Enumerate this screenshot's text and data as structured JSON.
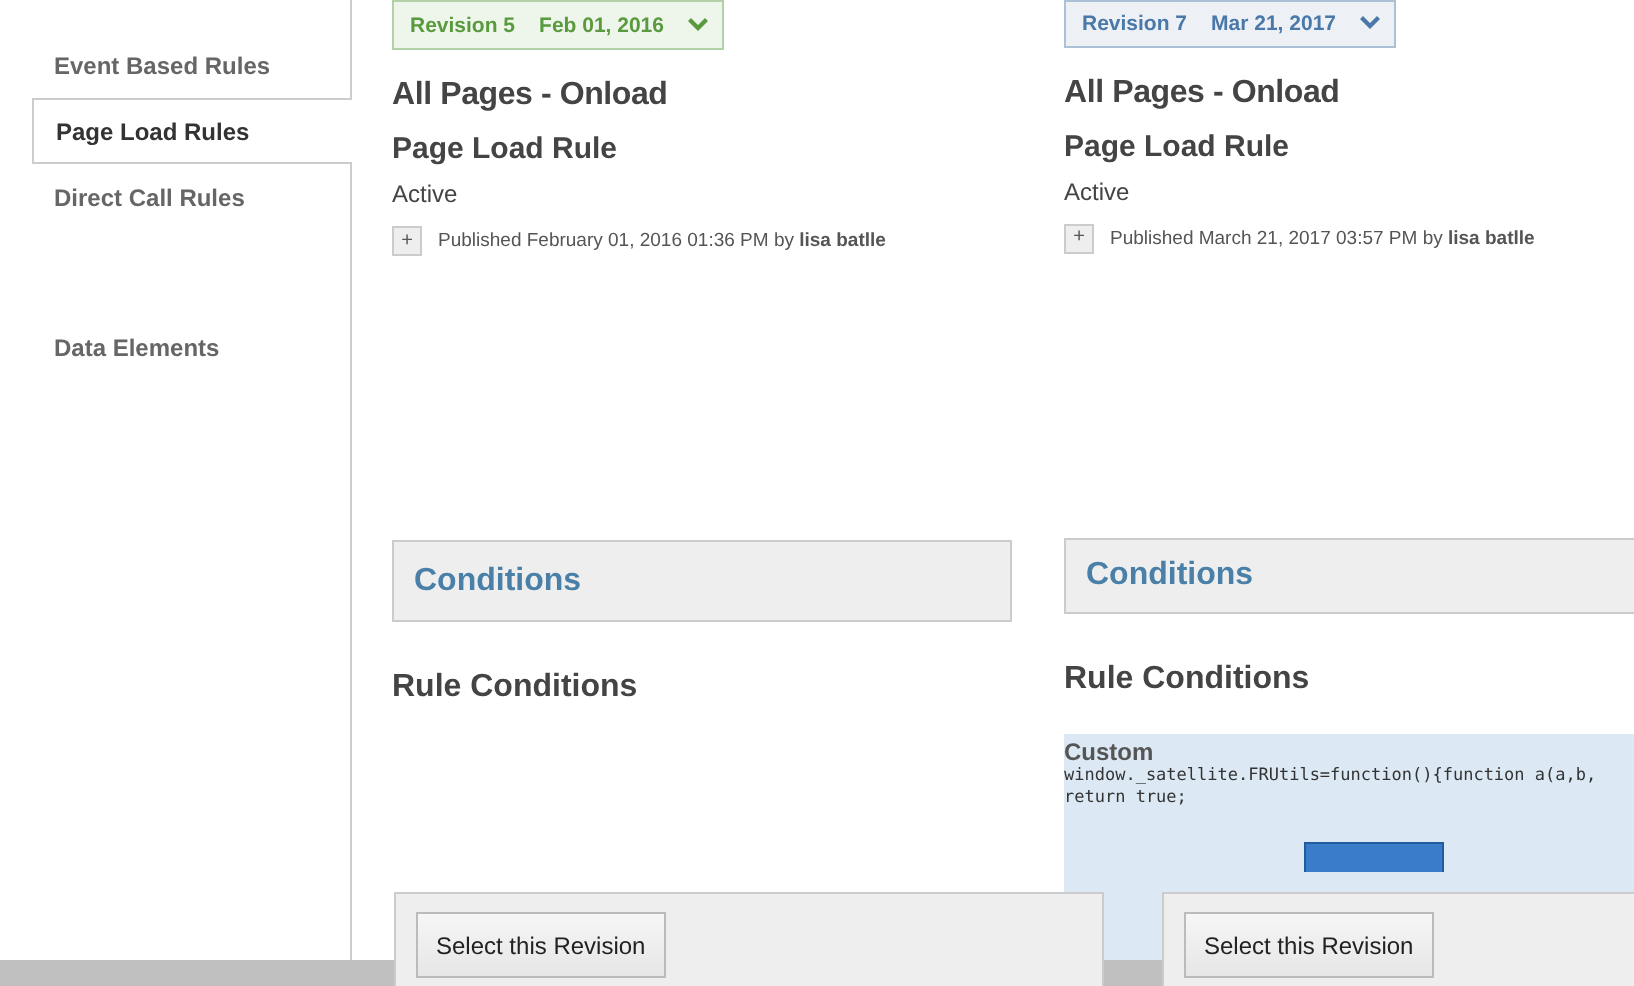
{
  "sidebar": {
    "items": [
      {
        "label": "Event Based Rules",
        "selected": false
      },
      {
        "label": "Page Load Rules",
        "selected": true
      },
      {
        "label": "Direct Call Rules",
        "selected": false
      },
      {
        "label": "Data Elements",
        "selected": false
      }
    ]
  },
  "revisions": [
    {
      "badge": {
        "revision": "Revision 5",
        "date": "Feb 01, 2016",
        "color": "#5a9a3e"
      },
      "name": "All Pages - Onload",
      "type": "Page Load Rule",
      "status": "Active",
      "expand_icon": "+",
      "published": "Published February 01, 2016 01:36 PM by ",
      "author": "lisa batlle",
      "section": "Conditions",
      "subsection": "Rule Conditions",
      "footer_button": "Select this Revision"
    },
    {
      "badge": {
        "revision": "Revision 7",
        "date": "Mar 21, 2017",
        "color": "#4a78a8"
      },
      "name": "All Pages - Onload",
      "type": "Page Load Rule",
      "status": "Active",
      "expand_icon": "+",
      "published": "Published March 21, 2017 03:57 PM by ",
      "author": "lisa batlle",
      "section": "Conditions",
      "subsection": "Rule Conditions",
      "conditions": [
        {
          "title": "Custom",
          "code": [
            "window._satellite.FRUtils=function(){function a(a,b,",
            "return true;"
          ]
        }
      ],
      "footer_button": "Select this Revision"
    }
  ]
}
